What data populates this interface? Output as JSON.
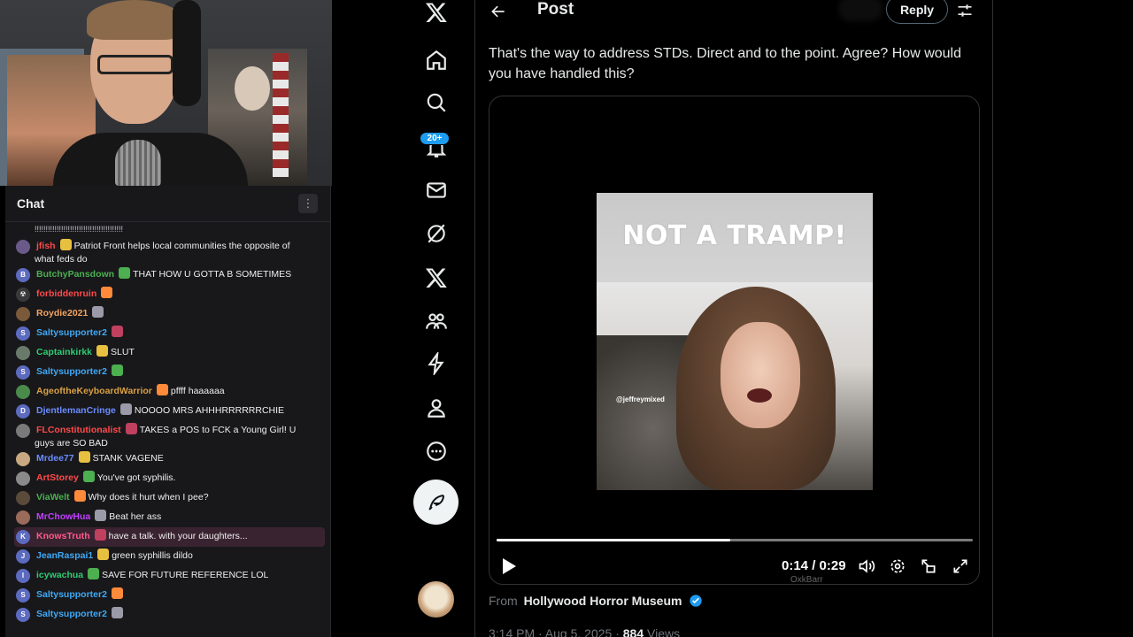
{
  "chat": {
    "title": "Chat",
    "menu_glyph": "⋮",
    "top_line": "!!!!!!!!!!!!!!!!!!!!!!!!!!!!!!!!!!!!!!!!",
    "messages": [
      {
        "user": "jfish",
        "text": "Patriot Front helps local communities the opposite of",
        "cont": "what feds do",
        "color": "#ff4a4a",
        "avatar": "#6a5a8a",
        "initial": ""
      },
      {
        "user": "ButchyPansdown",
        "text": "THAT HOW U GOTTA B SOMETIMES",
        "color": "#4caf50",
        "avatar": "#5c6bc0",
        "initial": "B"
      },
      {
        "user": "forbiddenruin",
        "text": "",
        "color": "#ff4a4a",
        "avatar": "#3a3a3a",
        "initial": "☢"
      },
      {
        "user": "Roydie2021",
        "text": "",
        "color": "#f4a460",
        "avatar": "#7a5a3a",
        "initial": ""
      },
      {
        "user": "Saltysupporter2",
        "text": "",
        "color": "#3fa9f5",
        "avatar": "#5c6bc0",
        "initial": "S"
      },
      {
        "user": "Captainkirkk",
        "text": "SLUT",
        "color": "#2ecc71",
        "avatar": "#6a7a6a",
        "initial": ""
      },
      {
        "user": "Saltysupporter2",
        "text": "",
        "color": "#3fa9f5",
        "avatar": "#5c6bc0",
        "initial": "S"
      },
      {
        "user": "AgeoftheKeyboardWarrior",
        "text": "pffff haaaaaa",
        "color": "#d9a040",
        "avatar": "#4a8a4a",
        "initial": ""
      },
      {
        "user": "DjentlemanCringe",
        "text": "NOOOO MRS AHHHRRRRRRCHIE",
        "color": "#6a8cff",
        "avatar": "#5c6bc0",
        "initial": "D"
      },
      {
        "user": "FLConstitutionalist",
        "text": "TAKES a POS to FCK a Young Girl! U",
        "cont": "guys are SO BAD",
        "color": "#ff4a4a",
        "avatar": "#7a7a7a",
        "initial": ""
      },
      {
        "user": "Mrdee77",
        "text": "STANK VAGENE",
        "color": "#6a8cff",
        "avatar": "#c8a880",
        "initial": ""
      },
      {
        "user": "ArtStorey",
        "text": "You've got syphilis.",
        "color": "#ff4a4a",
        "avatar": "#8a8a8a",
        "initial": ""
      },
      {
        "user": "ViaWelt",
        "text": "Why does it hurt when I pee?",
        "color": "#4caf50",
        "avatar": "#5a4a3a",
        "initial": ""
      },
      {
        "user": "MrChowHua",
        "text": "Beat her ass",
        "color": "#c040ff",
        "avatar": "#9a6a5a",
        "initial": ""
      },
      {
        "user": "KnowsTruth",
        "text": "have a talk. with your daughters...",
        "color": "#ff5a8a",
        "avatar": "#5c6bc0",
        "initial": "K",
        "highlight": true
      },
      {
        "user": "JeanRaspai1",
        "text": "green syphillis dildo",
        "color": "#3fa9f5",
        "avatar": "#5c6bc0",
        "initial": "J"
      },
      {
        "user": "icywachua",
        "text": "SAVE FOR FUTURE REFERENCE LOL",
        "color": "#2ecc71",
        "avatar": "#5c6bc0",
        "initial": "I"
      },
      {
        "user": "Saltysupporter2",
        "text": "",
        "color": "#3fa9f5",
        "avatar": "#5c6bc0",
        "initial": "S"
      },
      {
        "user": "Saltysupporter2",
        "text": "",
        "color": "#3fa9f5",
        "avatar": "#5c6bc0",
        "initial": "S"
      }
    ]
  },
  "sidebar": {
    "notifications_badge": "20+",
    "items": [
      "x-logo",
      "home-icon",
      "search-icon",
      "bell-icon",
      "mail-icon",
      "grok-icon",
      "x-premium-icon",
      "communities-icon",
      "lightning-icon",
      "profile-icon",
      "more-icon"
    ]
  },
  "header": {
    "title": "Post",
    "reply_label": "Reply"
  },
  "post": {
    "text": "That's the way to address STDs. Direct and to the point. Agree? How would you have handled this?",
    "video_caption": "NOT A TRAMP!",
    "video_watermark": "@jeffreymixed",
    "time_display": "0:14 / 0:29",
    "progress": 0.49,
    "overlay_logo": "OxkBarr",
    "from_label": "From",
    "source": "Hollywood Horror Museum",
    "meta_time": "3:14 PM · Aug 5, 2025 ·",
    "views_count": "884",
    "views_label": "Views"
  },
  "colors": {
    "accent": "#1d9bf0",
    "chat_bg": "#18181b",
    "highlight_bg": "#3a2330"
  }
}
